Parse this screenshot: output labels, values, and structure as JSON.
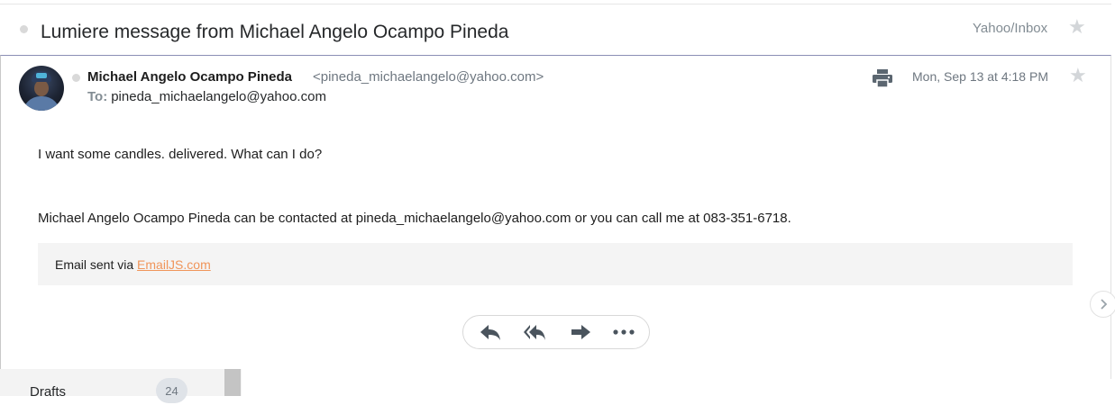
{
  "thread": {
    "subject": "Lumiere message from Michael Angelo Ocampo Pineda",
    "folder": "Yahoo/Inbox"
  },
  "message": {
    "sender_name": "Michael Angelo Ocampo Pineda",
    "sender_email": "<pineda_michaelangelo@yahoo.com>",
    "to_label": "To:",
    "to_address": "pineda_michaelangelo@yahoo.com",
    "date": "Mon, Sep 13 at 4:18 PM",
    "body_line_1": "I want some candles. delivered. What can I do?",
    "body_line_2": "Michael Angelo Ocampo Pineda can be contacted at pineda_michaelangelo@yahoo.com or you can call me at 083-351-6718.",
    "footer_prefix": "Email sent via ",
    "footer_link": "EmailJS.com"
  },
  "actions": [
    "reply-icon",
    "reply-all-icon",
    "forward-icon",
    "more-icon"
  ],
  "sidebar": {
    "drafts_label": "Drafts",
    "drafts_count": "24"
  },
  "colors": {
    "link": "#f0955a",
    "muted_text": "#828c93",
    "footer_bg": "#f4f4f4",
    "card_top_border": "#8b8fb5"
  }
}
